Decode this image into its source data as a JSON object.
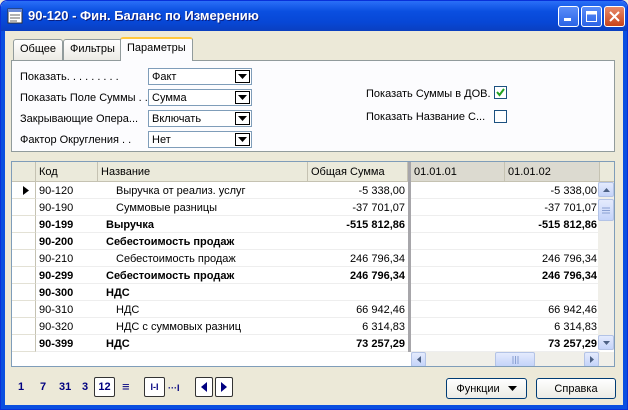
{
  "window": {
    "title": "90-120 - Фин. Баланс по Измерению"
  },
  "tabs": [
    {
      "label": "Общее"
    },
    {
      "label": "Фильтры"
    },
    {
      "label": "Параметры",
      "active": true
    }
  ],
  "params": {
    "show": {
      "label": "Показать. . . . . . . . .",
      "value": "Факт"
    },
    "amount_field": {
      "label": "Показать Поле Суммы . .",
      "value": "Сумма"
    },
    "closing": {
      "label": "Закрывающие Опера...",
      "value": "Включать"
    },
    "rounding": {
      "label": "Фактор Округления . .",
      "value": "Нет"
    },
    "show_amounts_acy": {
      "label": "Показать Суммы в ДОВ.",
      "checked": true
    },
    "show_name": {
      "label": "Показать Название С...",
      "checked": false
    }
  },
  "table": {
    "columns": {
      "code": "Код",
      "name": "Название",
      "total": "Общая Сумма",
      "period1": "01.01.01",
      "period2": "01.01.02"
    },
    "rows": [
      {
        "code": "90-120",
        "name": "Выручка от реализ. услуг",
        "total": "-5 338,00",
        "p1": "",
        "p2": "-5 338,00",
        "bold": false,
        "indent": true,
        "current": true
      },
      {
        "code": "90-190",
        "name": "Суммовые разницы",
        "total": "-37 701,07",
        "p1": "",
        "p2": "-37 701,07",
        "bold": false,
        "indent": true
      },
      {
        "code": "90-199",
        "name": "Выручка",
        "total": "-515 812,86",
        "p1": "",
        "p2": "-515 812,86",
        "bold": true,
        "indent": false
      },
      {
        "code": "90-200",
        "name": "Себестоимость продаж",
        "total": "",
        "p1": "",
        "p2": "",
        "bold": true,
        "indent": false
      },
      {
        "code": "90-210",
        "name": "Себестоимость продаж",
        "total": "246 796,34",
        "p1": "",
        "p2": "246 796,34",
        "bold": false,
        "indent": true
      },
      {
        "code": "90-299",
        "name": "Себестоимость продаж",
        "total": "246 796,34",
        "p1": "",
        "p2": "246 796,34",
        "bold": true,
        "indent": false
      },
      {
        "code": "90-300",
        "name": "НДС",
        "total": "",
        "p1": "",
        "p2": "",
        "bold": true,
        "indent": false
      },
      {
        "code": "90-310",
        "name": "НДС",
        "total": "66 942,46",
        "p1": "",
        "p2": "66 942,46",
        "bold": false,
        "indent": true
      },
      {
        "code": "90-320",
        "name": "НДС с суммовых разниц",
        "total": "6 314,83",
        "p1": "",
        "p2": "6 314,83",
        "bold": false,
        "indent": true
      },
      {
        "code": "90-399",
        "name": "НДС",
        "total": "73 257,29",
        "p1": "",
        "p2": "73 257,29",
        "bold": true,
        "indent": false
      }
    ]
  },
  "pager": {
    "p1": "1",
    "p7": "7",
    "p31": "31",
    "p3": "3",
    "p12": "12",
    "sep": "≡",
    "range": "I-I",
    "dots": "···I"
  },
  "buttons": {
    "functions": "Функции",
    "help": "Справка"
  },
  "colors": {
    "titlebar": "#0a4fe0",
    "check": "#21a121"
  }
}
